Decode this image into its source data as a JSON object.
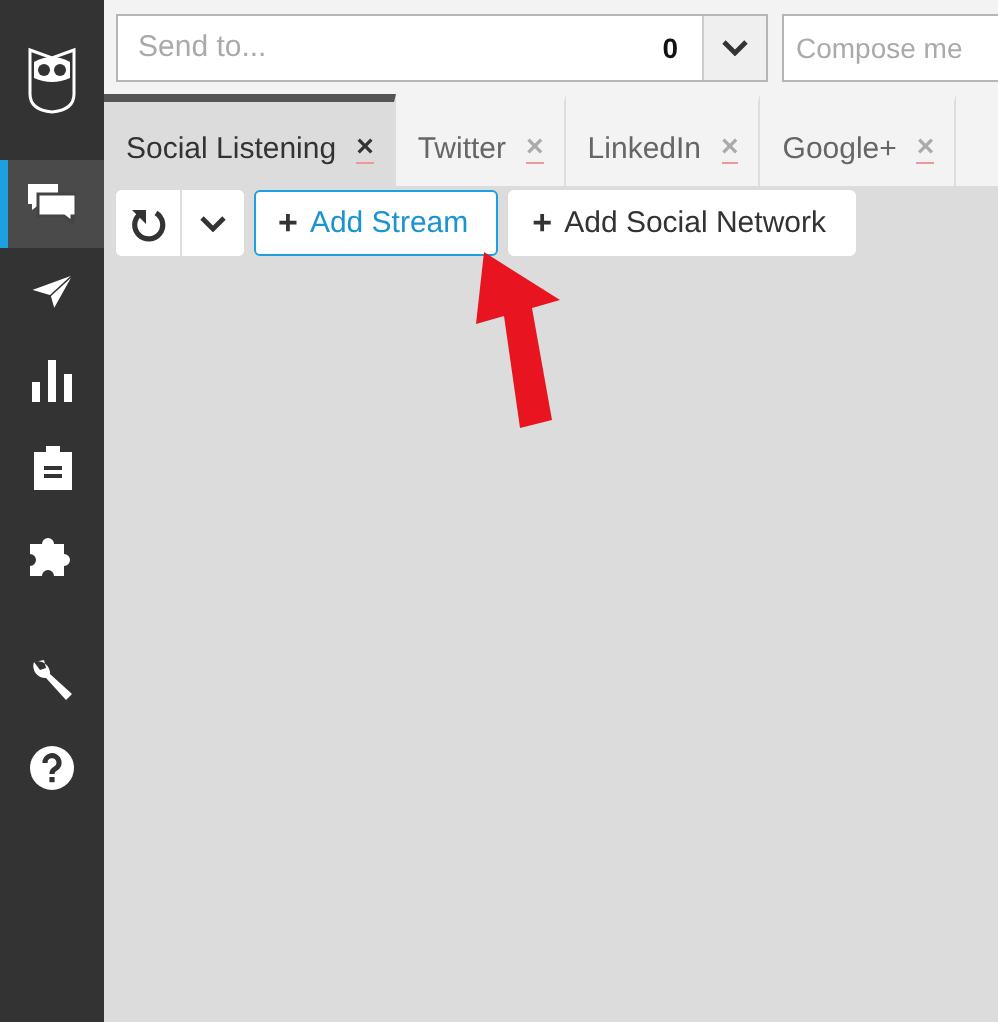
{
  "sidebar": {
    "items": [
      {
        "kind": "logo",
        "selected": false
      },
      {
        "kind": "streams",
        "selected": true
      },
      {
        "kind": "publisher",
        "selected": false
      },
      {
        "kind": "analytics",
        "selected": false
      },
      {
        "kind": "assignments",
        "selected": false
      },
      {
        "kind": "apps",
        "selected": false
      },
      {
        "kind": "tools",
        "selected": false
      },
      {
        "kind": "help",
        "selected": false
      }
    ]
  },
  "compose_bar": {
    "send_to": {
      "placeholder": "Send to...",
      "count": "0"
    },
    "message": {
      "placeholder": "Compose me"
    }
  },
  "tabs": [
    {
      "label": "Social Listening",
      "close": "×",
      "selected": true
    },
    {
      "label": "Twitter",
      "close": "×",
      "selected": false
    },
    {
      "label": "LinkedIn",
      "close": "×",
      "selected": false
    },
    {
      "label": "Google+",
      "close": "×",
      "selected": false
    }
  ],
  "toolbar": {
    "add_stream": {
      "icon": "+",
      "label": "Add Stream"
    },
    "add_network": {
      "icon": "+",
      "label": "Add Social Network"
    }
  }
}
